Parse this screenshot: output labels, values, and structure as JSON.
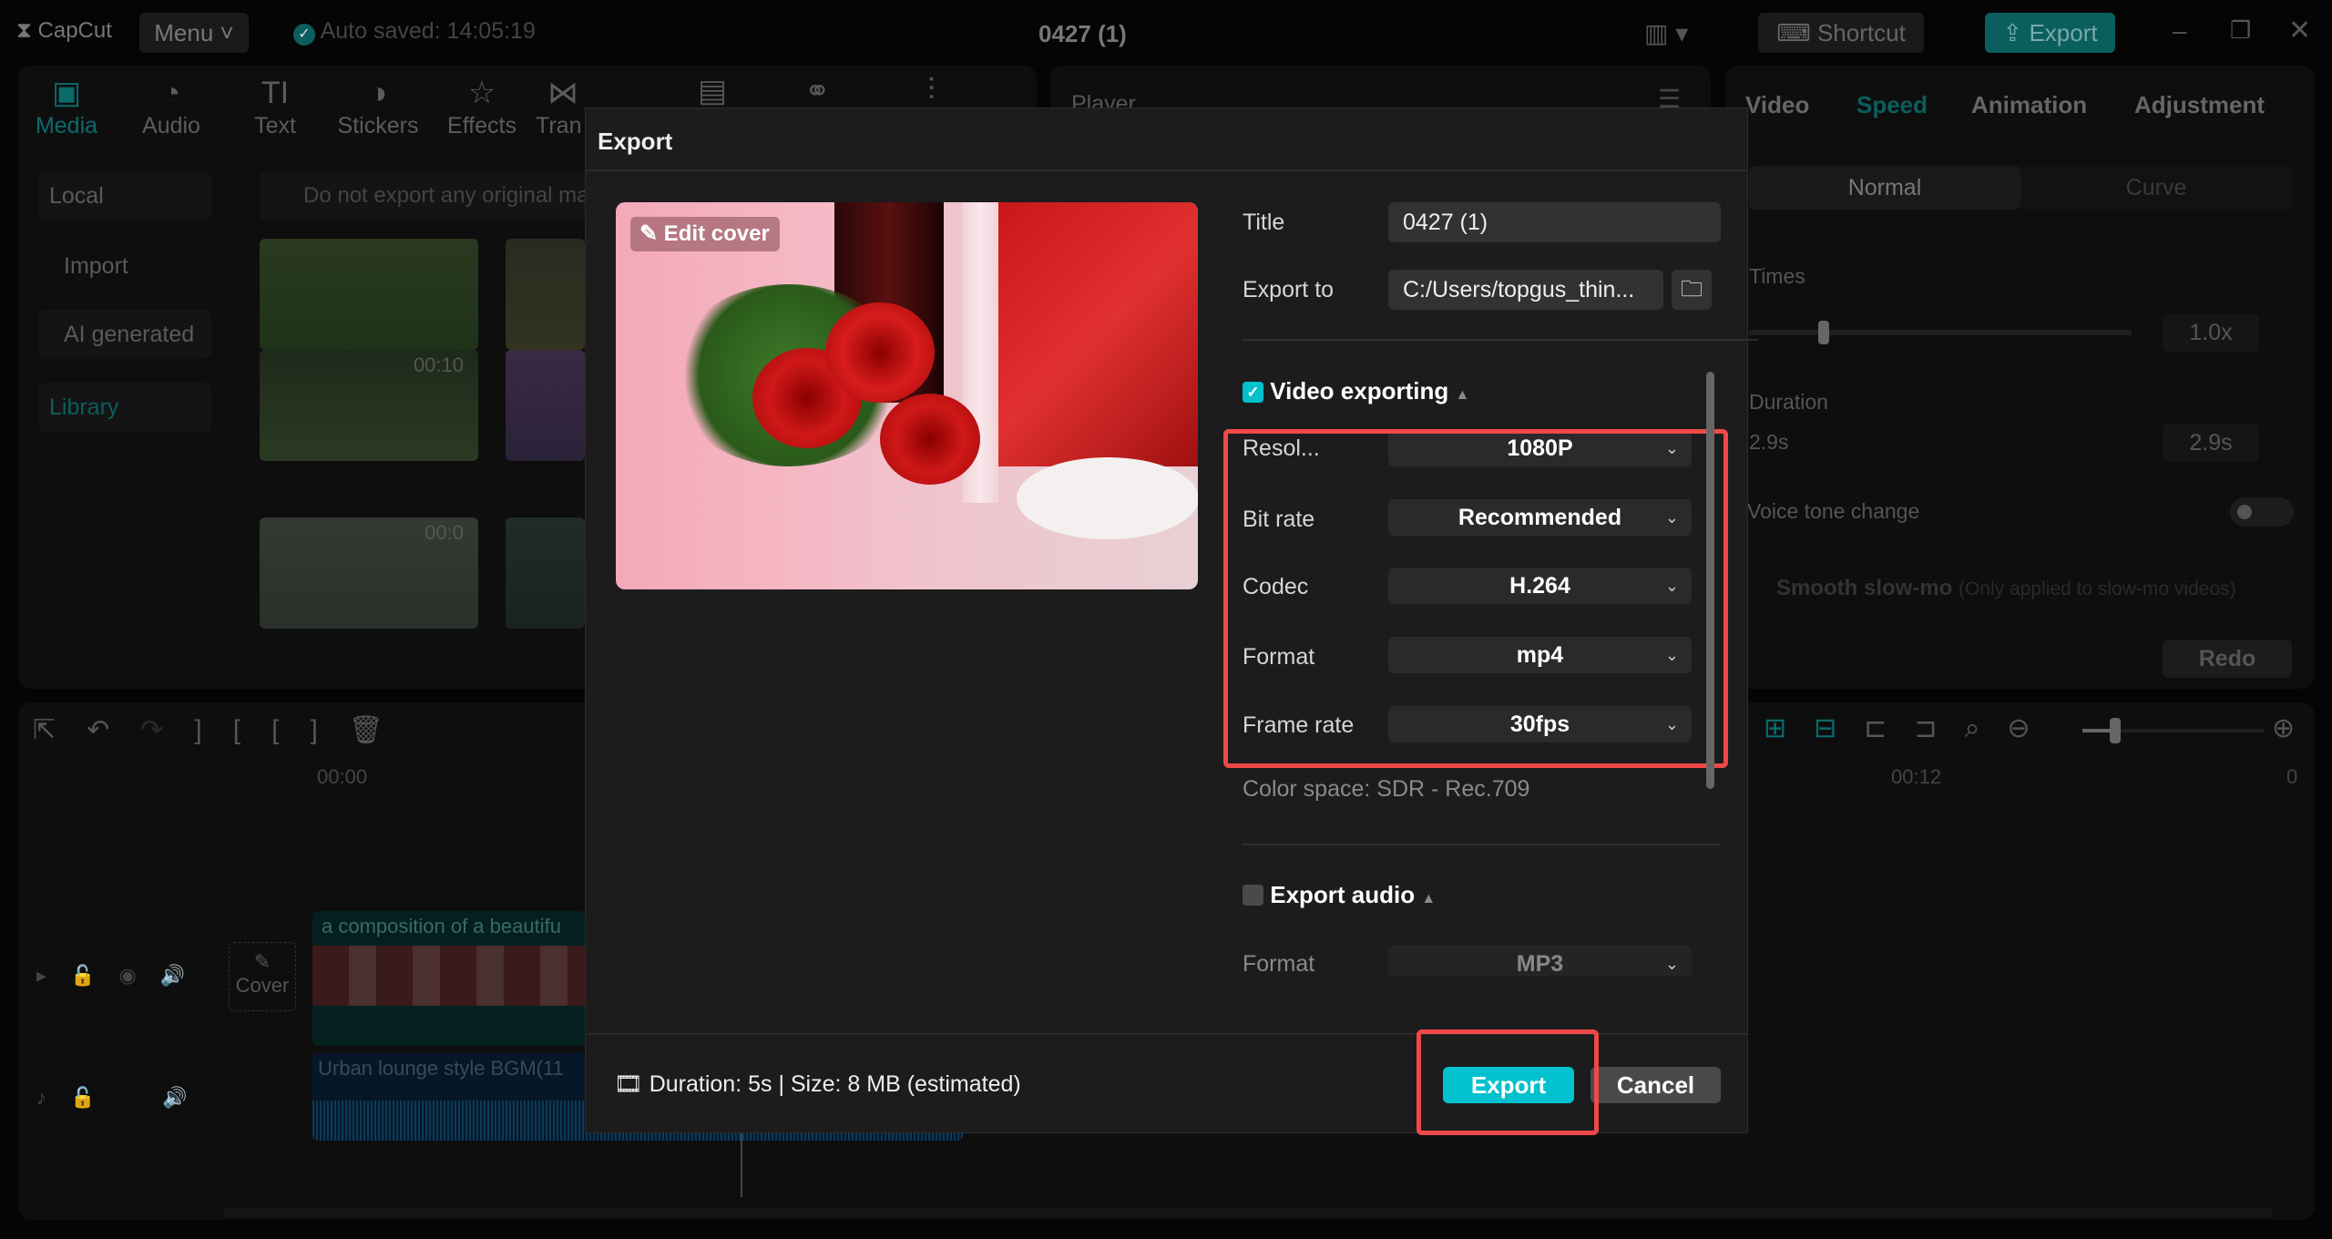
{
  "titlebar": {
    "logo": "CapCut",
    "menu": "Menu",
    "autosave": "Auto saved: 14:05:19",
    "project_title": "0427 (1)",
    "shortcut": "Shortcut",
    "export": "Export"
  },
  "toolbar": {
    "items": [
      "Media",
      "Audio",
      "Text",
      "Stickers",
      "Effects",
      "Tran"
    ]
  },
  "media": {
    "sidebar": [
      "Local",
      "Import",
      "AI generated",
      "Library"
    ],
    "notice": "Do not export any original ma",
    "durations": [
      "00:10",
      "00:0"
    ]
  },
  "player": {
    "title": "Player"
  },
  "inspector": {
    "tabs": [
      "Video",
      "Speed",
      "Animation",
      "Adjustment"
    ],
    "modes": [
      "Normal",
      "Curve"
    ],
    "times_label": "Times",
    "times_value": "1.0x",
    "duration_label": "Duration",
    "duration_from": "2.9s",
    "duration_value": "2.9s",
    "voice_tone": "Voice tone change",
    "smooth": "Smooth slow-mo",
    "smooth_note": "(Only applied to slow-mo videos)",
    "redo": "Redo"
  },
  "timeline": {
    "ruler": [
      "00:00",
      "00:12",
      "0"
    ],
    "video_clip": "a composition of a beautifu",
    "audio_clip": "Urban lounge style BGM(11",
    "cover": "Cover"
  },
  "dialog": {
    "title": "Export",
    "edit_cover": "Edit cover",
    "title_label": "Title",
    "title_value": "0427 (1)",
    "export_to_label": "Export to",
    "export_to_value": "C:/Users/topgus_thin...",
    "video_section": "Video exporting",
    "video_checked": true,
    "rows": [
      {
        "label": "Resol...",
        "value": "1080P"
      },
      {
        "label": "Bit rate",
        "value": "Recommended"
      },
      {
        "label": "Codec",
        "value": "H.264"
      },
      {
        "label": "Format",
        "value": "mp4"
      },
      {
        "label": "Frame rate",
        "value": "30fps"
      }
    ],
    "color_space": "Color space: SDR - Rec.709",
    "audio_section": "Export audio",
    "audio_checked": false,
    "audio_format_label": "Format",
    "audio_format_value": "MP3",
    "footer_info": "Duration: 5s | Size: 8 MB (estimated)",
    "export_button": "Export",
    "cancel_button": "Cancel"
  },
  "colors": {
    "accent": "#00c1cd",
    "highlight": "#f04848",
    "teal_dim": "#0b5e5e"
  }
}
